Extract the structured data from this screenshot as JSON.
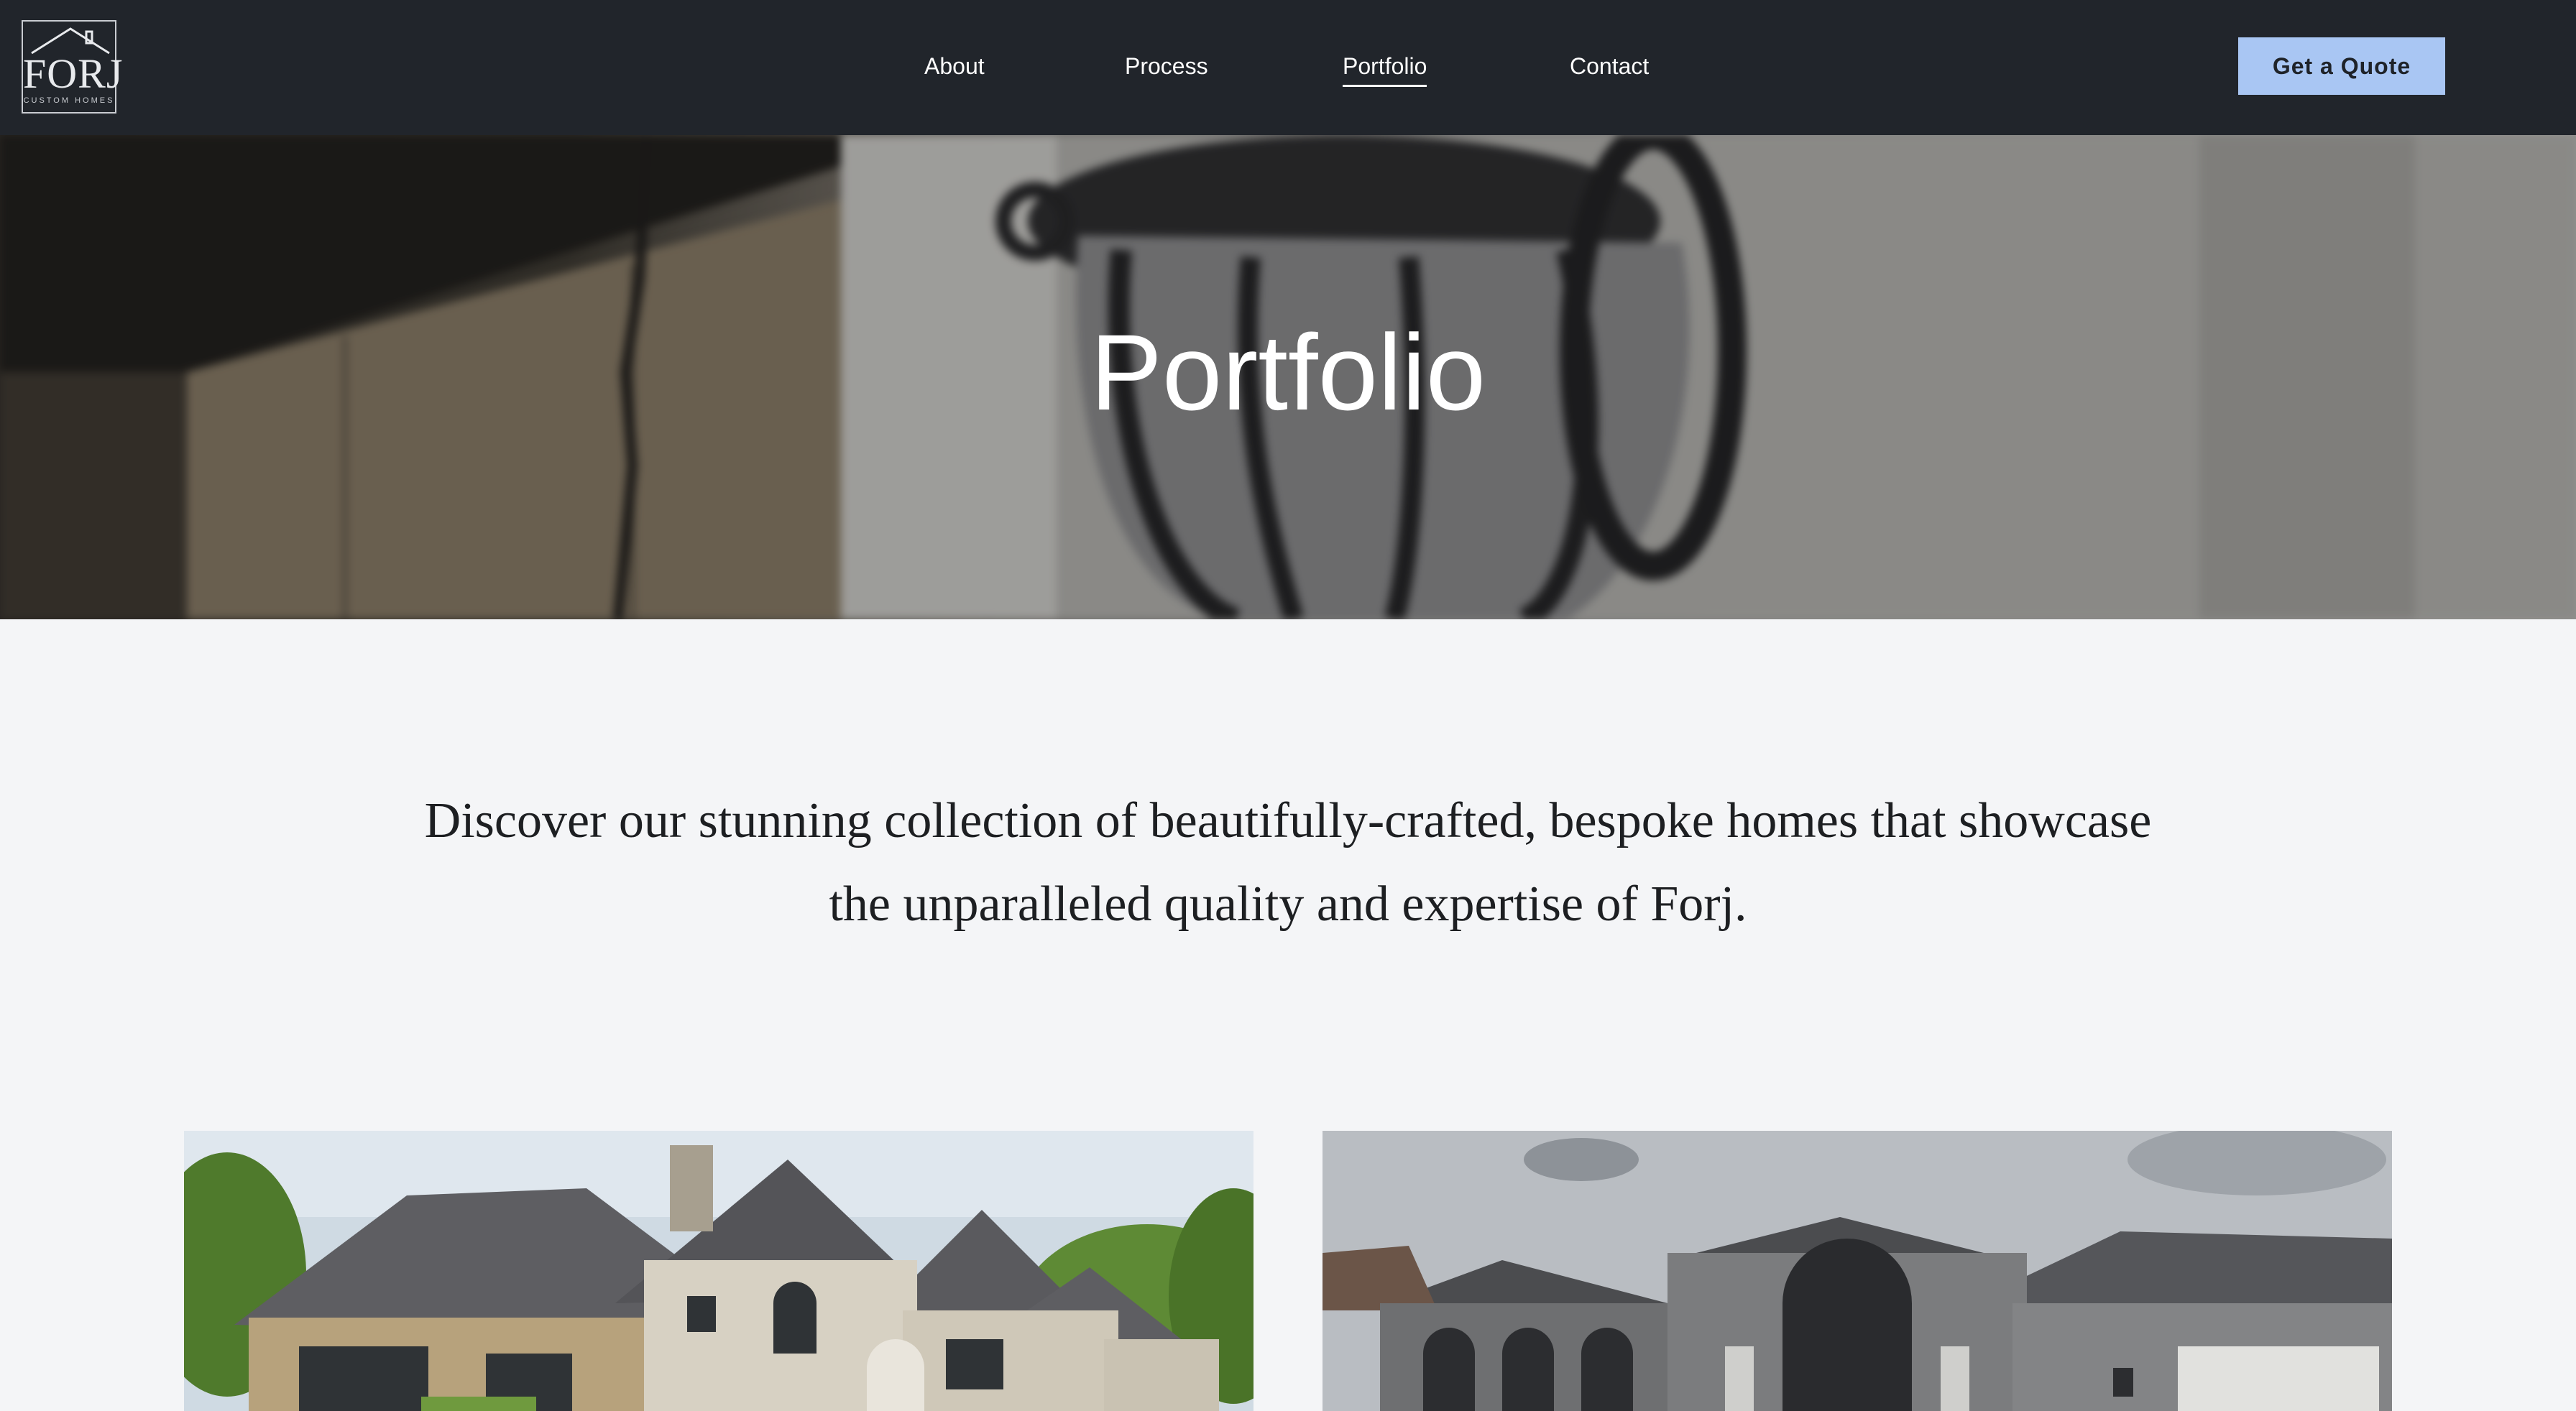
{
  "brand": {
    "logo_word": "FORJ",
    "logo_sub": "CUSTOM HOMES"
  },
  "nav": {
    "items": [
      {
        "label": "About"
      },
      {
        "label": "Process"
      },
      {
        "label": "Portfolio",
        "active": true
      },
      {
        "label": "Contact"
      }
    ],
    "cta_label": "Get a Quote"
  },
  "hero": {
    "title": "Portfolio"
  },
  "intro": {
    "text": "Discover our stunning collection of beautifully-crafted, bespoke homes that showcase the unparalleled quality and expertise of Forj."
  },
  "colors": {
    "header_bg": "#21252b",
    "cta_bg": "#a9c6f3",
    "page_bg": "#f4f5f7"
  }
}
